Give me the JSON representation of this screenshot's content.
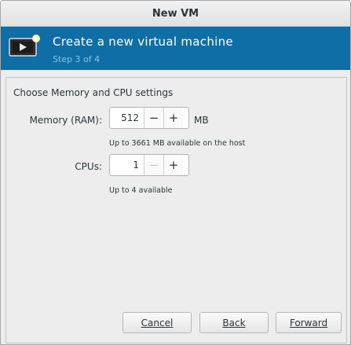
{
  "window": {
    "title": "New VM"
  },
  "banner": {
    "icon": "virtual-machine-monitor-icon",
    "title": "Create a new virtual machine",
    "step": "Step 3 of 4"
  },
  "page": {
    "heading": "Choose Memory and CPU settings",
    "memory": {
      "label": "Memory (RAM):",
      "value": "512",
      "decrement": "−",
      "increment": "+",
      "unit": "MB",
      "hint": "Up to 3661 MB available on the host"
    },
    "cpus": {
      "label": "CPUs:",
      "value": "1",
      "decrement": "−",
      "increment": "+",
      "hint": "Up to 4 available"
    }
  },
  "buttons": {
    "cancel": "Cancel",
    "back": "Back",
    "forward": "Forward"
  },
  "colors": {
    "banner": "#0e6ea5",
    "banner_step": "#8ec2e0"
  }
}
